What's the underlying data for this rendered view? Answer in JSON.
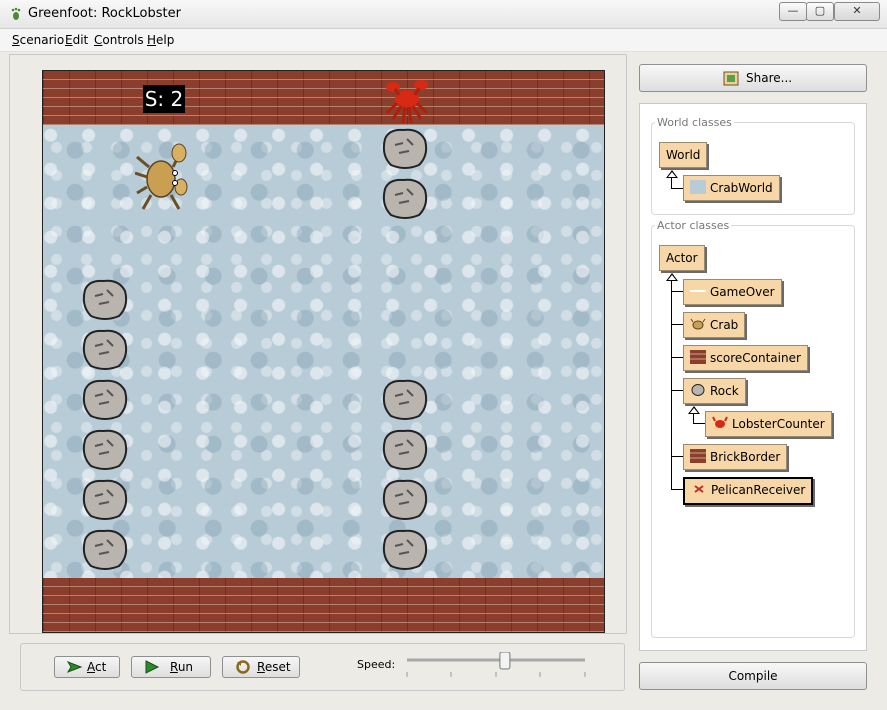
{
  "window": {
    "title": "Greenfoot: RockLobster",
    "minimize_glyph": "—",
    "maximize_glyph": "▢",
    "close_glyph": "✕",
    "app_icon": "footprint-icon"
  },
  "menu": [
    {
      "mnemonic": "S",
      "rest": "cenario"
    },
    {
      "mnemonic": "E",
      "rest": "dit"
    },
    {
      "mnemonic": "C",
      "rest": "ontrols"
    },
    {
      "mnemonic": "H",
      "rest": "elp"
    }
  ],
  "world": {
    "score": "S: 2"
  },
  "controls": {
    "act_mnemonic": "A",
    "act_rest": "ct",
    "run_mnemonic": "R",
    "run_rest": "un",
    "reset_mnemonic": "R",
    "reset_rest": "eset",
    "speed_label": "Speed:",
    "speed_value": 0.55
  },
  "share": {
    "label": "Share..."
  },
  "classes": {
    "world_label": "World classes",
    "actor_label": "Actor classes",
    "world": "World",
    "crabworld": "CrabWorld",
    "actor": "Actor",
    "gameover": "GameOver",
    "crab": "Crab",
    "scorecontainer": "scoreContainer",
    "rock": "Rock",
    "lobstercounter": "LobsterCounter",
    "brickborder": "BrickBorder",
    "pelicanreceiver": "PelicanReceiver",
    "selected": "PelicanReceiver"
  },
  "compile": {
    "label": "Compile"
  },
  "colors": {
    "class_box": "#f7d6a8",
    "brick": "#8b3e2c",
    "water": "#b8ccd8"
  }
}
